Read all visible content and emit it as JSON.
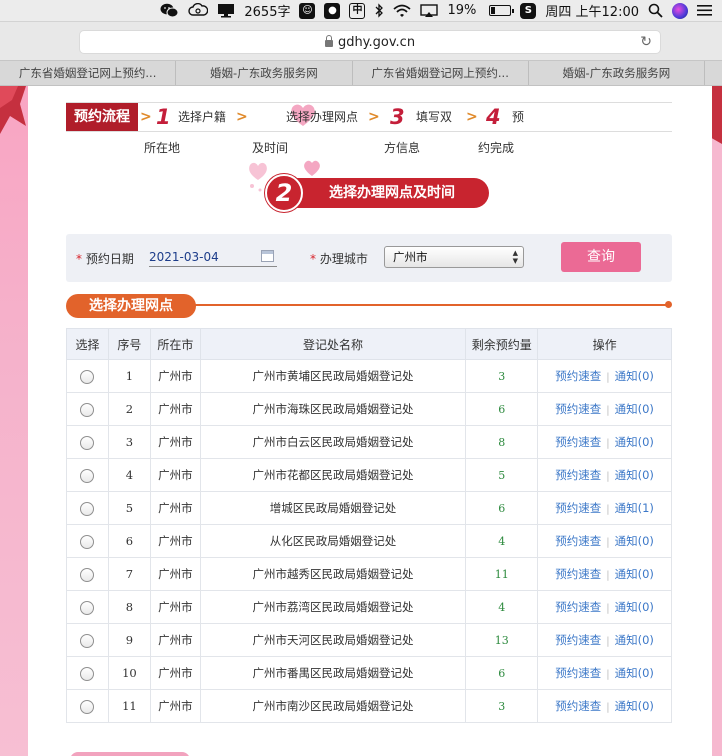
{
  "menubar": {
    "word_count": "2655字",
    "battery": "19%",
    "clock": "周四 上午12:00"
  },
  "browser": {
    "url": "gdhy.gov.cn",
    "tabs": [
      "广东省婚姻登记网上预约...",
      "婚姻-广东政务服务网",
      "广东省婚姻登记网上预约...",
      "婚姻-广东政务服务网"
    ]
  },
  "steps": {
    "title": "预约流程",
    "items": [
      {
        "num": "1",
        "line1": "选择户籍",
        "line2": "所在地"
      },
      {
        "num": "2",
        "line1": "选择办理网点",
        "line2": "及时间"
      },
      {
        "num": "3",
        "line1": "填写双",
        "line2": "方信息"
      },
      {
        "num": "4",
        "line1": "预",
        "line2": "约完成"
      }
    ],
    "arrow": ">"
  },
  "banner": {
    "num": "2",
    "text": "选择办理网点及时间"
  },
  "search": {
    "date_label": "预约日期",
    "date_value": "2021-03-04",
    "city_label": "办理城市",
    "city_value": "广州市",
    "button": "查询",
    "required_mark": "*"
  },
  "section_title": "选择办理网点",
  "table": {
    "headers": [
      "选择",
      "序号",
      "所在市",
      "登记处名称",
      "剩余预约量",
      "操作"
    ],
    "action_quick": "预约速查",
    "action_sep": "|",
    "rows": [
      {
        "no": "1",
        "city": "广州市",
        "name": "广州市黄埔区民政局婚姻登记处",
        "remaining": "3",
        "notify": "通知(0)"
      },
      {
        "no": "2",
        "city": "广州市",
        "name": "广州市海珠区民政局婚姻登记处",
        "remaining": "6",
        "notify": "通知(0)"
      },
      {
        "no": "3",
        "city": "广州市",
        "name": "广州市白云区民政局婚姻登记处",
        "remaining": "8",
        "notify": "通知(0)"
      },
      {
        "no": "4",
        "city": "广州市",
        "name": "广州市花都区民政局婚姻登记处",
        "remaining": "5",
        "notify": "通知(0)"
      },
      {
        "no": "5",
        "city": "广州市",
        "name": "增城区民政局婚姻登记处",
        "remaining": "6",
        "notify": "通知(1)"
      },
      {
        "no": "6",
        "city": "广州市",
        "name": "从化区民政局婚姻登记处",
        "remaining": "4",
        "notify": "通知(0)"
      },
      {
        "no": "7",
        "city": "广州市",
        "name": "广州市越秀区民政局婚姻登记处",
        "remaining": "11",
        "notify": "通知(0)"
      },
      {
        "no": "8",
        "city": "广州市",
        "name": "广州市荔湾区民政局婚姻登记处",
        "remaining": "4",
        "notify": "通知(0)"
      },
      {
        "no": "9",
        "city": "广州市",
        "name": "广州市天河区民政局婚姻登记处",
        "remaining": "13",
        "notify": "通知(0)"
      },
      {
        "no": "10",
        "city": "广州市",
        "name": "广州市番禺区民政局婚姻登记处",
        "remaining": "6",
        "notify": "通知(0)"
      },
      {
        "no": "11",
        "city": "广州市",
        "name": "广州市南沙区民政局婚姻登记处",
        "remaining": "3",
        "notify": "通知(0)"
      }
    ]
  },
  "colors": {
    "brand_red": "#b01d2a",
    "accent_orange": "#e2632b",
    "button_pink": "#eb6a95",
    "link_blue": "#3c78c8",
    "count_green": "#2d8a3e"
  }
}
